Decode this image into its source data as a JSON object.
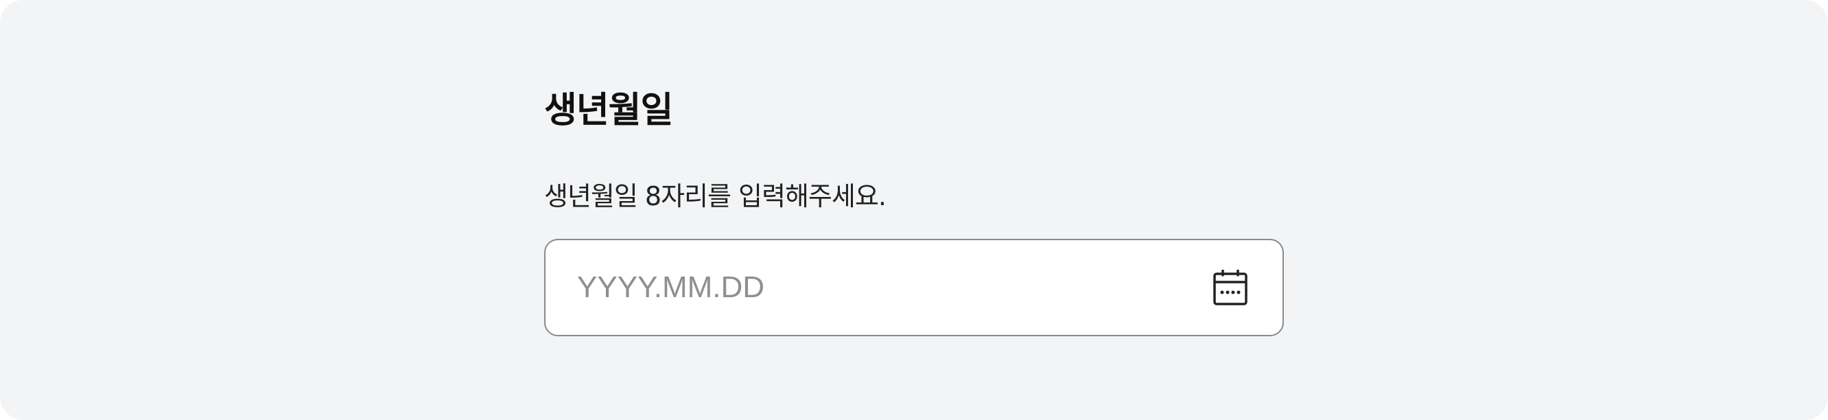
{
  "birthdate": {
    "title": "생년월일",
    "description": "생년월일 8자리를 입력해주세요.",
    "input": {
      "value": "",
      "placeholder": "YYYY.MM.DD"
    },
    "calendar_icon": "calendar-icon"
  },
  "colors": {
    "background": "#f3f4f6",
    "field_border": "#8a8a8a",
    "placeholder": "#8f8f8f",
    "text": "#111111"
  }
}
